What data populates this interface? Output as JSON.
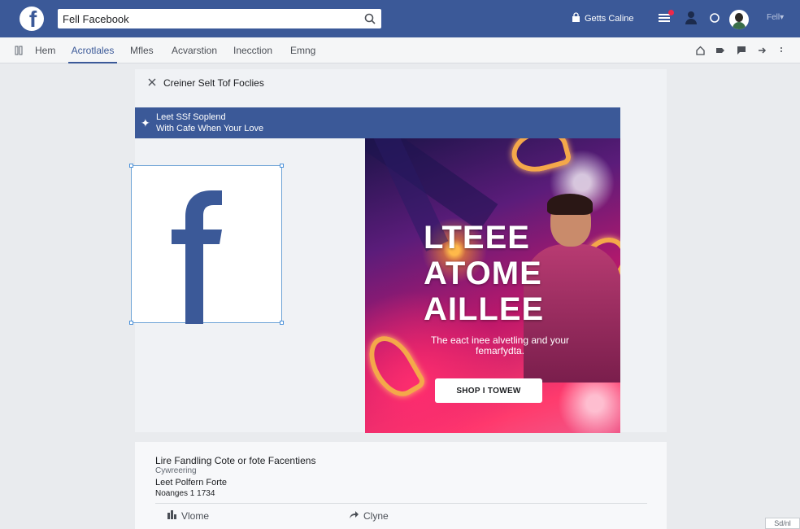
{
  "topbar": {
    "search_value": "Fell Facebook",
    "lock_label": "Getts Caline",
    "extra_label": "Fell▾"
  },
  "subnav": {
    "items": [
      {
        "label": "Hem"
      },
      {
        "label": "Acrotlales"
      },
      {
        "label": "Mfles"
      },
      {
        "label": "Acvarstion"
      },
      {
        "label": "Inecction"
      },
      {
        "label": "Emng"
      }
    ],
    "active_index": 1
  },
  "panel": {
    "title": "Creiner Selt Tof Foclies",
    "strip_line1": "Leet SSf Soplend",
    "strip_line2": "With Cafe When Your Love"
  },
  "ad": {
    "headline_1": "LTEEE",
    "headline_2": "ATOME",
    "headline_3": "AILLEE",
    "tagline": "The eact inee alvetling and your femarfydta.",
    "cta": "SHOP I TOWEW"
  },
  "card": {
    "line1": "Lire Fandling Cote or fote Facentiens",
    "line2": "Cywreering",
    "line3": "Leet Polfern Forte",
    "line4": "Noanges 1 1734",
    "action_left": "Vlome",
    "action_right": "Clyne"
  },
  "corner_label": "Sd/nl",
  "colors": {
    "brand": "#3b5998",
    "background": "#e9ebee"
  }
}
